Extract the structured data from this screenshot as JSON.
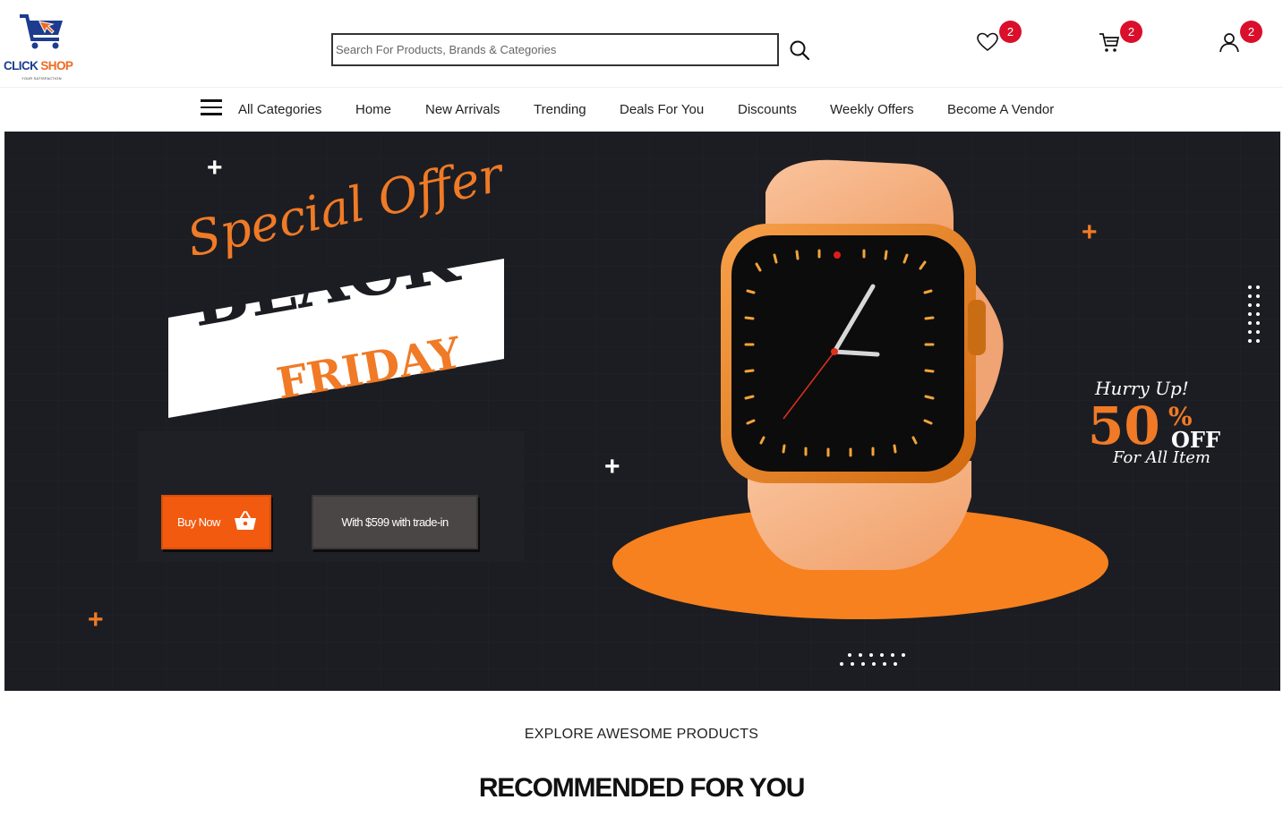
{
  "brand": {
    "name_part1": "CLICK",
    "name_part2": "SHOP",
    "tagline": "YOUR SATISFACTION"
  },
  "search": {
    "placeholder": "Search For Products, Brands & Categories"
  },
  "header": {
    "wishlist_count": "2",
    "cart_count": "2",
    "account_count": "2"
  },
  "nav": {
    "items": [
      {
        "label": "All Categories"
      },
      {
        "label": "Home"
      },
      {
        "label": "New Arrivals"
      },
      {
        "label": "Trending"
      },
      {
        "label": "Deals For You"
      },
      {
        "label": "Discounts"
      },
      {
        "label": "Weekly Offers"
      },
      {
        "label": "Become A Vendor"
      }
    ]
  },
  "hero": {
    "special_offer": "Special Offer",
    "black": "BLACK",
    "friday": "FRIDAY",
    "buy_now_label": "Buy Now",
    "trade_in_label": "With $599 with trade-in",
    "hurry_up": "Hurry Up!",
    "discount_value": "50",
    "discount_percent": "%",
    "discount_off": "OFF",
    "for_all_item": "For All Item"
  },
  "section": {
    "eyebrow": "EXPLORE AWESOME PRODUCTS",
    "title": "RECOMMENDED FOR YOU"
  },
  "colors": {
    "brand_blue": "#1d3c8f",
    "brand_orange": "#f06a1d",
    "hero_bg": "#1c1d22",
    "buy_button": "#f25a0f",
    "badge_red": "#d90f2b"
  },
  "icons": [
    "cart-logo-icon",
    "search-icon",
    "heart-icon",
    "cart-icon",
    "user-icon",
    "hamburger-icon",
    "basket-icon"
  ]
}
